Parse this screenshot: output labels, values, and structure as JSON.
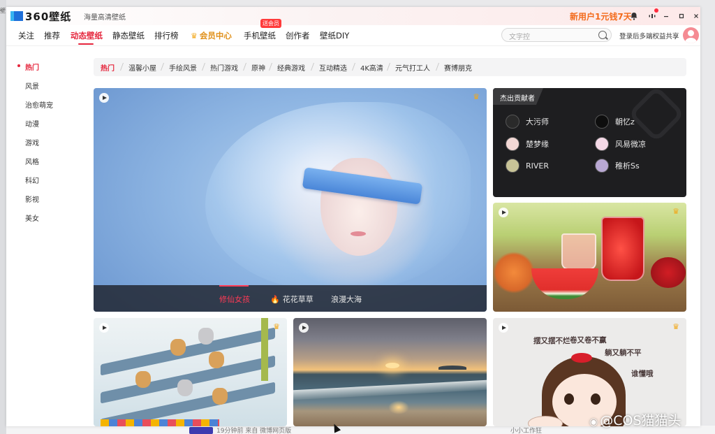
{
  "app": {
    "name": "360壁纸",
    "slogan": "海量高清壁纸",
    "promo": "新用户1元钱7天",
    "desktop_left_tag": "壁"
  },
  "nav": {
    "items": [
      {
        "label": "关注"
      },
      {
        "label": "推荐"
      },
      {
        "label": "动态壁纸",
        "active": true
      },
      {
        "label": "静态壁纸"
      },
      {
        "label": "排行榜"
      },
      {
        "label": "会员中心",
        "vip": true
      },
      {
        "label": "手机壁纸"
      },
      {
        "label": "创作者"
      },
      {
        "label": "壁纸DIY"
      }
    ],
    "badge": "送会员",
    "search_placeholder": "文字控",
    "login_tip": "登录后多端权益共享"
  },
  "sidebar": {
    "items": [
      {
        "label": "热门",
        "active": true
      },
      {
        "label": "风景"
      },
      {
        "label": "治愈萌宠"
      },
      {
        "label": "动漫"
      },
      {
        "label": "游戏"
      },
      {
        "label": "风格"
      },
      {
        "label": "科幻"
      },
      {
        "label": "影视"
      },
      {
        "label": "美女"
      }
    ]
  },
  "tags": [
    {
      "label": "热门",
      "active": true
    },
    {
      "label": "温馨小屋"
    },
    {
      "label": "手绘风景"
    },
    {
      "label": "热门游戏"
    },
    {
      "label": "原神"
    },
    {
      "label": "经典游戏"
    },
    {
      "label": "互动精选"
    },
    {
      "label": "4K高清"
    },
    {
      "label": "元气打工人"
    },
    {
      "label": "赛博朋克"
    }
  ],
  "hero": {
    "tabs": [
      {
        "label": "修仙女孩",
        "active": true
      },
      {
        "label": "花花草草",
        "hot": true
      },
      {
        "label": "浪漫大海"
      }
    ]
  },
  "contributors": {
    "title": "杰出贡献者",
    "people": [
      {
        "name": "大污师",
        "color": "#2a2a2a"
      },
      {
        "name": "朝忆z",
        "color": "#0e0e0e"
      },
      {
        "name": "楚梦缘",
        "color": "#f2d7d4"
      },
      {
        "name": "风易微凉",
        "color": "#f4d8e6"
      },
      {
        "name": "RIVER",
        "color": "#c8c397"
      },
      {
        "name": "稚析Ss",
        "color": "#b9a8d3"
      }
    ]
  },
  "girl_card": {
    "texts": [
      "摆又摆不烂",
      "卷又卷不赢",
      "躺又躺不平",
      "谁懂哦"
    ]
  },
  "bottom_strip": {
    "meta": "19分钟前 来自 微博网页版",
    "right": "小小工作狂"
  },
  "watermark": "@COS猫猫头",
  "colors": {
    "accent": "#e5253c",
    "promo": "#f36b1c",
    "vip": "#e0901a"
  }
}
